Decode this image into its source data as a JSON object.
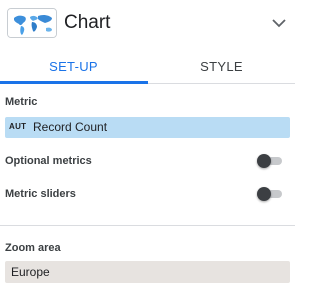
{
  "header": {
    "title": "Chart",
    "thumbnail_icon": "world-map-icon",
    "expand_icon": "chevron-down-icon"
  },
  "tabs": [
    {
      "label": "SET-UP",
      "active": true
    },
    {
      "label": "STYLE",
      "active": false
    }
  ],
  "metric": {
    "label": "Metric",
    "type_badge": "AUT",
    "value": "Record Count"
  },
  "optional_metrics": {
    "label": "Optional metrics",
    "enabled": false
  },
  "metric_sliders": {
    "label": "Metric sliders",
    "enabled": false
  },
  "zoom_area": {
    "label": "Zoom area",
    "value": "Europe"
  },
  "colors": {
    "accent": "#1a73e8",
    "metric_chip": "#b9dcf4",
    "zoom_field": "#e7e3e0"
  }
}
